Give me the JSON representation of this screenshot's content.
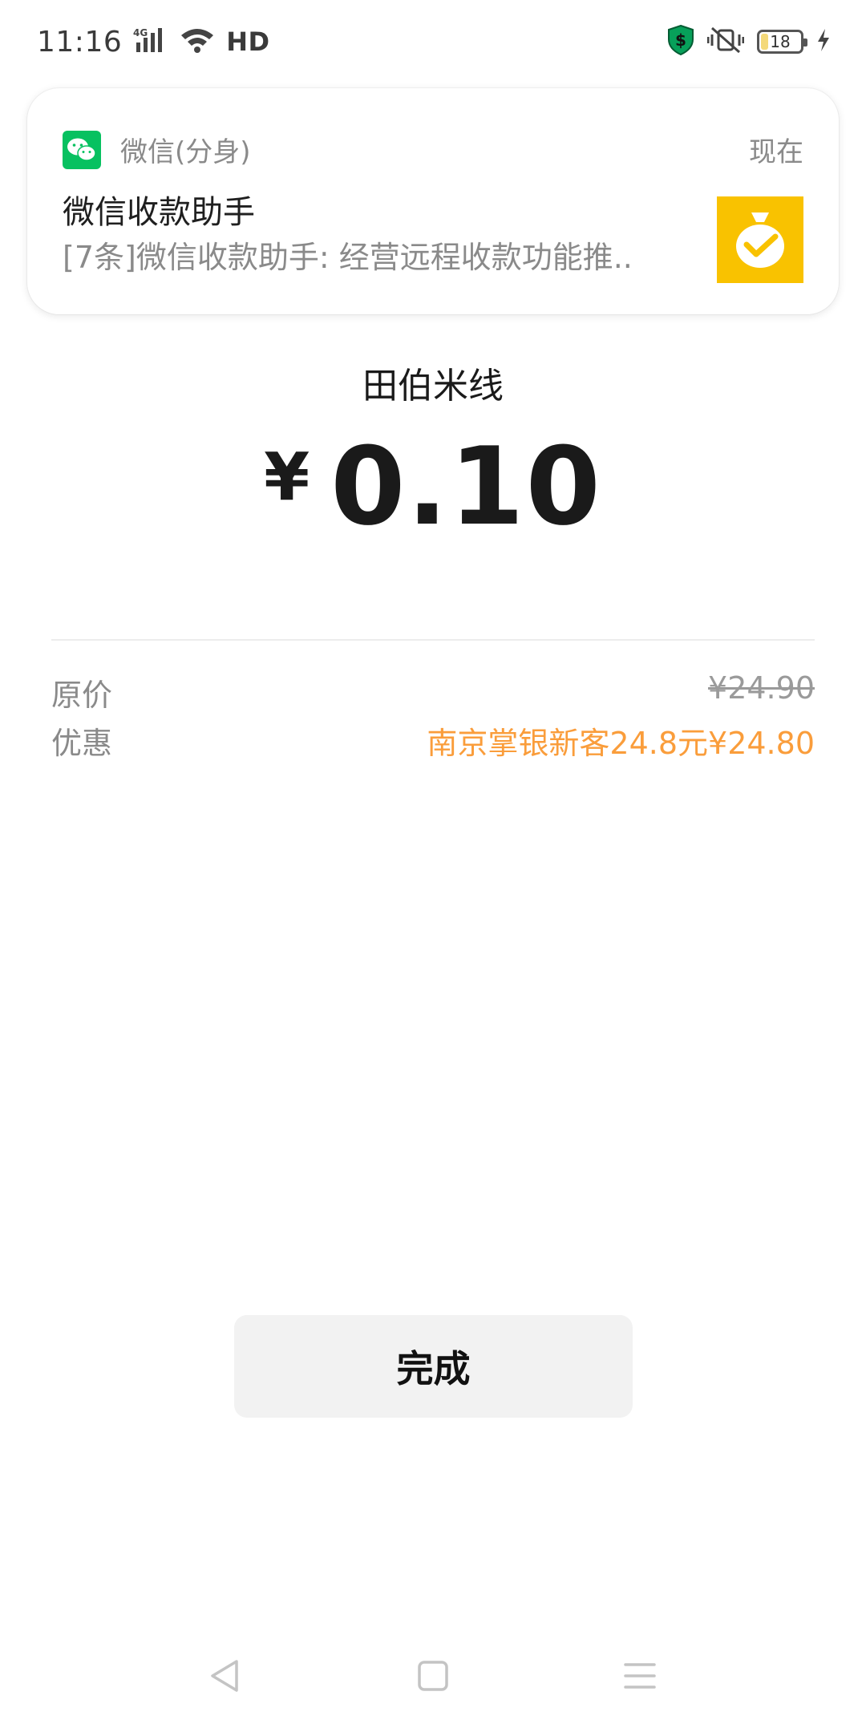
{
  "status_bar": {
    "time": "11:16",
    "network": "4G",
    "hd": "HD",
    "battery": "18"
  },
  "notification": {
    "app_name": "微信(分身)",
    "time": "现在",
    "title": "微信收款助手",
    "body": "[7条]微信收款助手: 经营远程收款功能推.."
  },
  "payment": {
    "merchant": "田伯米线",
    "currency_symbol": "¥",
    "amount": "0.10",
    "original_price_label": "原价",
    "original_price": "¥24.90",
    "discount_label": "优惠",
    "discount_value": "南京掌银新客24.8元¥24.80"
  },
  "done_button": {
    "label": "完成"
  },
  "colors": {
    "wechat_green": "#07c160",
    "discount_orange": "#fa9d3b",
    "thumb_yellow": "#f9c200"
  }
}
